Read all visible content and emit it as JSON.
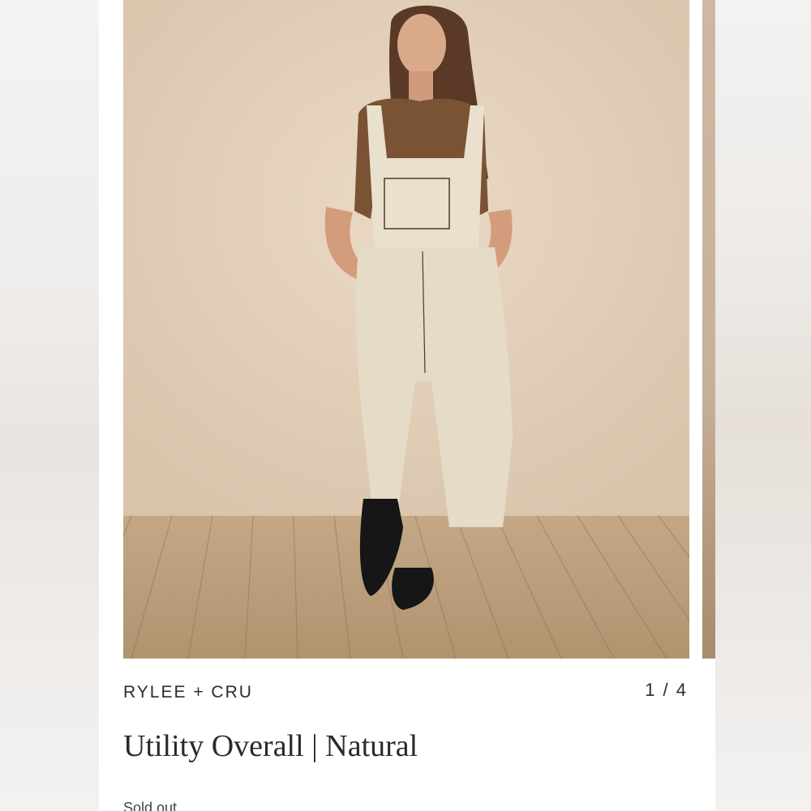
{
  "product": {
    "brand": "RYLEE + CRU",
    "image_counter": "1 / 4",
    "title": "Utility Overall | Natural",
    "sub_text_partial": "Sold out"
  },
  "colors": {
    "wall": "#e2d2be",
    "floor": "#b59a7a",
    "overall": "#e9dfcc",
    "top": "#7a5234",
    "shoe": "#161616"
  },
  "icons": {
    "carousel": "product-photo"
  }
}
